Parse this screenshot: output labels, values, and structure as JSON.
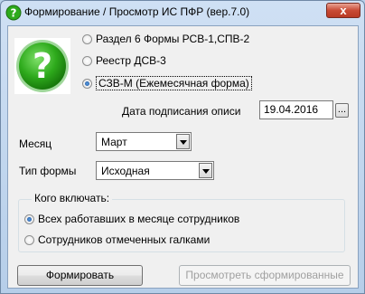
{
  "window": {
    "title": "Формирование / Просмотр ИС ПФР (вер.7.0)",
    "close_label": "x"
  },
  "form_types": {
    "options": [
      "Раздел 6 Формы РСВ-1,СПВ-2",
      "Реестр ДСВ-3",
      "СЗВ-М (Ежемесячная форма)"
    ],
    "selected_index": 2
  },
  "date": {
    "label": "Дата подписания описи",
    "value": "19.04.2016",
    "picker_label": "..."
  },
  "month": {
    "label": "Месяц",
    "value": "Март"
  },
  "form_kind": {
    "label": "Тип формы",
    "value": "Исходная"
  },
  "include": {
    "title": "Кого включать:",
    "options": [
      "Всех работавших в месяце сотрудников",
      "Сотрудников отмеченных галками"
    ],
    "selected_index": 0
  },
  "buttons": {
    "generate": "Формировать",
    "view": "Просмотреть сформированные"
  },
  "colors": {
    "icon_green": "#2eaa1c",
    "close_red": "#c94a35"
  }
}
